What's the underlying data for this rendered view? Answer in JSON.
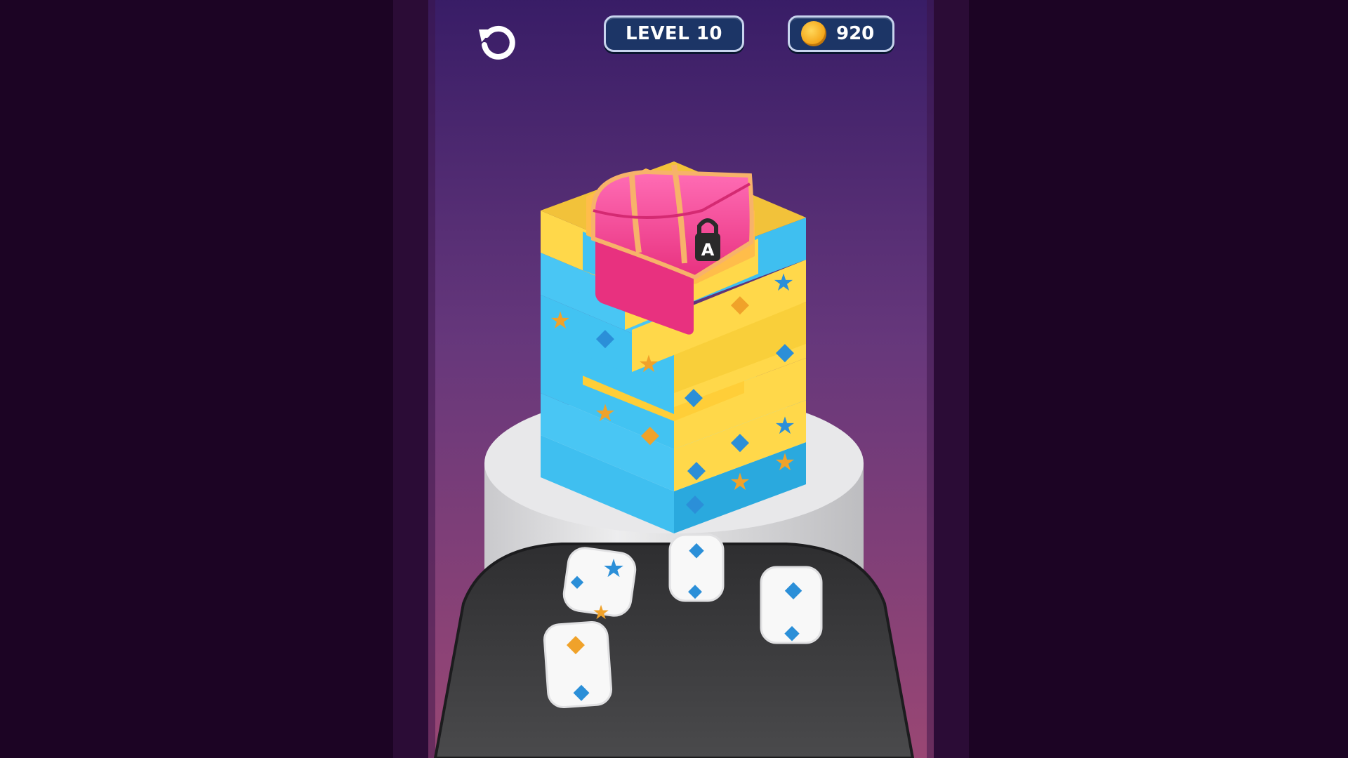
{
  "hud": {
    "level_label": "LEVEL 10",
    "coins": "920",
    "restart_icon": "restart-icon",
    "coin_icon": "coin-icon"
  },
  "scene": {
    "chest_lock_letter": "A",
    "colors": {
      "background_dark": "#1c0424",
      "spotlight": "#7a3f86",
      "block_yellow": "#ffd84a",
      "block_blue": "#42c3f2",
      "chest_pink": "#f0449a",
      "chest_trim": "#f7b26a",
      "pedestal": "#e4e4e6",
      "tray": "#3c3c3e",
      "die_white": "#f8f8f8",
      "symbol_blue": "#2b8fd8",
      "symbol_orange": "#f0a22a"
    },
    "tower_blocks": [
      {
        "color": "yellow",
        "symbol": "star"
      },
      {
        "color": "blue",
        "symbol": "diamond"
      },
      {
        "color": "yellow",
        "symbol": "diamond"
      },
      {
        "color": "blue",
        "symbol": "star"
      },
      {
        "color": "blue",
        "symbol": "diamond"
      },
      {
        "color": "yellow",
        "symbol": "star"
      },
      {
        "color": "blue",
        "symbol": "diamond"
      },
      {
        "color": "yellow",
        "symbol": "star"
      },
      {
        "color": "yellow",
        "symbol": "diamond"
      },
      {
        "color": "blue",
        "symbol": "diamond"
      },
      {
        "color": "blue",
        "symbol": "star"
      },
      {
        "color": "blue",
        "symbol": "diamond"
      },
      {
        "color": "yellow",
        "symbol": "star"
      },
      {
        "color": "blue",
        "symbol": "diamond"
      },
      {
        "color": "yellow",
        "symbol": "star"
      }
    ],
    "dice": [
      {
        "top": "star",
        "front": "star",
        "side": "diamond",
        "top_color": "blue",
        "front_color": "orange"
      },
      {
        "top": "diamond",
        "front": "diamond",
        "top_color": "blue",
        "front_color": "blue"
      },
      {
        "top": "diamond",
        "front": "diamond",
        "top_color": "blue",
        "front_color": "blue"
      },
      {
        "top": "diamond",
        "front": "diamond",
        "top_color": "orange",
        "front_color": "blue"
      }
    ]
  }
}
